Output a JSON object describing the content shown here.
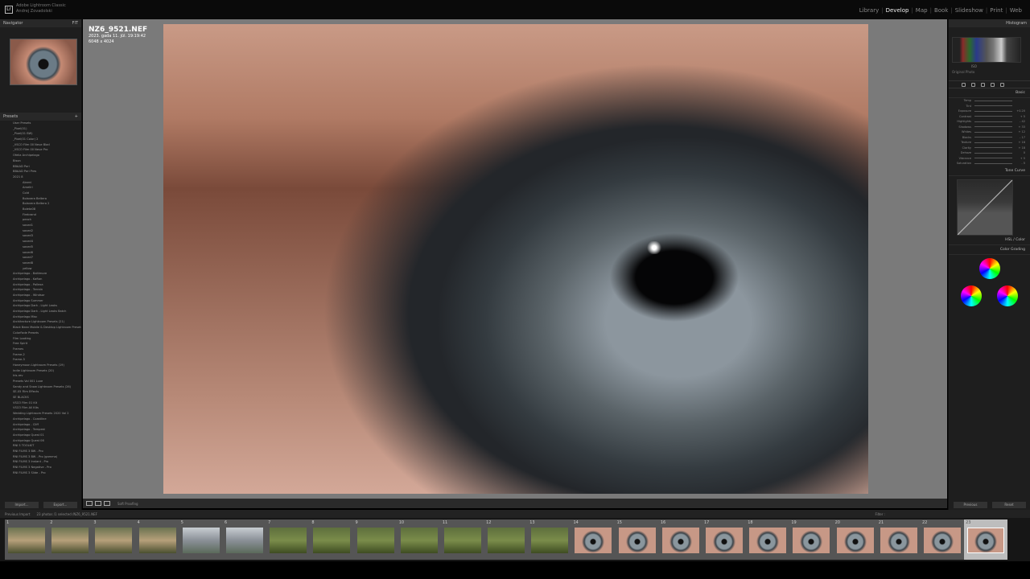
{
  "app": {
    "catalog_line1": "Adobe Lightroom Classic",
    "catalog_line2": "Andrej Zovadolski"
  },
  "modules": [
    "Library",
    "Develop",
    "Map",
    "Book",
    "Slideshow",
    "Print",
    "Web"
  ],
  "active_module": "Develop",
  "navigator": {
    "title": "Navigator",
    "zoom": "FIT"
  },
  "presets": {
    "title": "Presets",
    "items": [
      "User Presets",
      "_Pixel(01)",
      "_Pixel(01 BW)",
      "_Pixel(01 Color) 2",
      "_VSCO Film 00 Neue Blad",
      "_VSCO Film 00 Neue Pro",
      "Ofelia Archipelago",
      "Bison",
      "BBAAD Pori",
      "BBAAD Pori Pres",
      "2021 8"
    ],
    "subitems": [
      "Akarni",
      "Ameliri",
      "Cold",
      "Bolavera Beltera",
      "Bolavera Beltera 2",
      "Boleta08",
      "Firebrand",
      "peach",
      "saved1",
      "saved2",
      "saved3",
      "saved4",
      "saved5",
      "saved6",
      "saved7",
      "saved8",
      "yellow"
    ],
    "more": [
      "Archipelago - Baltimore",
      "Archipelago - Kaftan",
      "Archipelago - Pallexa",
      "Archipelago - Terrain",
      "Archipelago - Windsor",
      "Archipelago Summer",
      "Archipelago Dark - Light Leaks",
      "Archipelago Dark - Light Leaks Batch",
      "Archipelago Misc",
      "Architecture Lightroom Presets (21)",
      "Black Bean Mobile & Desktop Lightroom Presets",
      "ColorFade Presets",
      "Film Looking",
      "Free Spirit",
      "Frames",
      "Frame-2",
      "Frame-3",
      "Honeymoon Lightroom Presets (19)",
      "Indie Lightroom Presets (20)",
      "Iris-rev",
      "Presets Vol 001 Luxe",
      "Sandy and Snow Lightroom Presets (26)",
      "SE-05 Film Effects",
      "SE BLACKS",
      "VSCO Film 01 Kit",
      "VSCO Film All Kits",
      "Wedding Lightroom Presets 2020 Vol 2",
      "Archipelago - Coastline",
      "Archipelago - Cliff",
      "Archipelago - Tempest",
      "Archipelago Quest 01",
      "Archipelago Quest 06",
      "RNI 5 TOOLKIT",
      "RNI FILMS 3 BW - Pro",
      "RNI FILMS 3 BW - Pro (gamma)",
      "RNI FILMS 3 Instant - Pro",
      "RNI FILMS 3 Negative - Pro",
      "RNI FILMS 3 Slide - Pro"
    ],
    "import_label": "Import...",
    "export_label": "Export..."
  },
  "image": {
    "filename": "NZ6_9521.NEF",
    "date": "2023. gada 11. jūl. 19:19:42",
    "dimensions": "6048 x 4024"
  },
  "toolbar": {
    "softproof": "Soft Proofing"
  },
  "right": {
    "histogram_title": "Histogram",
    "iso": "ISO",
    "original": "Original Photo",
    "basic_title": "Basic",
    "tone_curve_title": "Tone Curve",
    "hsl_title": "HSL / Color",
    "color_grading_title": "Color Grading",
    "sliders": [
      "Temp",
      "Tint",
      "Exposure",
      "Contrast",
      "Highlights",
      "Shadows",
      "Whites",
      "Blacks",
      "Texture",
      "Clarity",
      "Dehaze",
      "Vibrance",
      "Saturation"
    ],
    "slider_values": [
      "",
      "",
      "+0.20",
      "+ 5",
      "- 42",
      "+ 33",
      "+ 12",
      "- 17",
      "+ 16",
      "+ 18",
      "0",
      "+ 5",
      "- 5"
    ],
    "previous_label": "Previous",
    "reset_label": "Reset"
  },
  "filmbar": {
    "source": "Previous Import",
    "count": "23 photos /1 selected /NZ6_9521.NEF",
    "filter": "Filter :"
  },
  "filmstrip": [
    {
      "n": "1",
      "t": "people"
    },
    {
      "n": "2",
      "t": "people"
    },
    {
      "n": "3",
      "t": "people"
    },
    {
      "n": "4",
      "t": "people"
    },
    {
      "n": "5",
      "t": "city"
    },
    {
      "n": "6",
      "t": "city"
    },
    {
      "n": "7",
      "t": "nature"
    },
    {
      "n": "8",
      "t": "nature"
    },
    {
      "n": "9",
      "t": "nature"
    },
    {
      "n": "10",
      "t": "nature"
    },
    {
      "n": "11",
      "t": "nature"
    },
    {
      "n": "12",
      "t": "nature"
    },
    {
      "n": "13",
      "t": "nature"
    },
    {
      "n": "14",
      "t": "eye"
    },
    {
      "n": "15",
      "t": "eye"
    },
    {
      "n": "16",
      "t": "eye"
    },
    {
      "n": "17",
      "t": "eye"
    },
    {
      "n": "18",
      "t": "eye"
    },
    {
      "n": "19",
      "t": "eye"
    },
    {
      "n": "20",
      "t": "eye"
    },
    {
      "n": "21",
      "t": "eye"
    },
    {
      "n": "22",
      "t": "eye"
    },
    {
      "n": "23",
      "t": "eye"
    }
  ],
  "selected_frame": "23"
}
